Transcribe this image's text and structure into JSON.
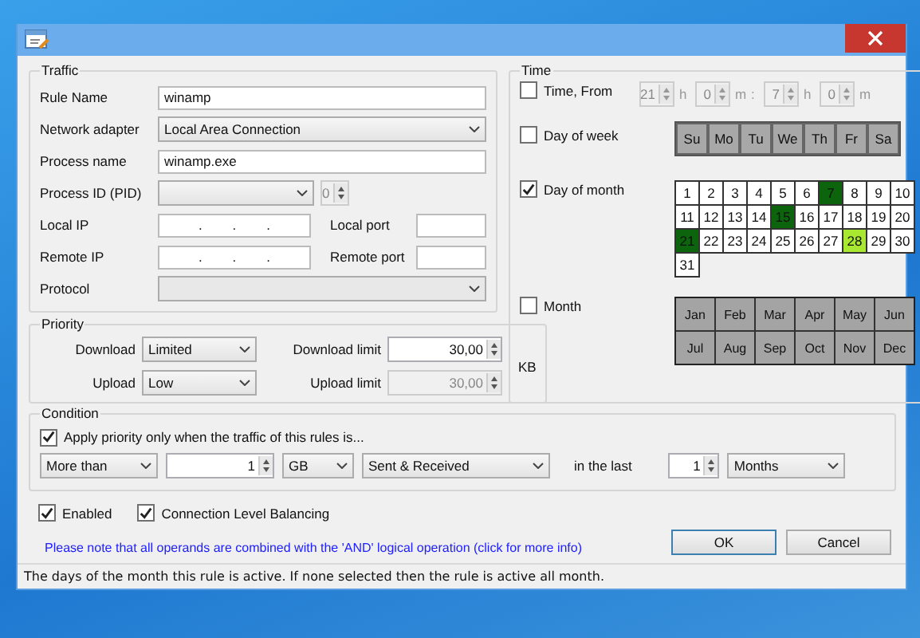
{
  "traffic": {
    "title": "Traffic",
    "rule_name": {
      "label": "Rule Name",
      "value": "winamp"
    },
    "network_adapter": {
      "label": "Network adapter",
      "value": "Local Area Connection"
    },
    "process_name": {
      "label": "Process name",
      "value": "winamp.exe"
    },
    "process_id": {
      "label": "Process ID (PID)",
      "value": "0"
    },
    "local_ip": {
      "label": "Local IP",
      "separators": [
        ".",
        ".",
        "."
      ]
    },
    "local_port": {
      "label": "Local port"
    },
    "remote_ip": {
      "label": "Remote IP",
      "separators": [
        ".",
        ".",
        "."
      ]
    },
    "remote_port": {
      "label": "Remote port"
    },
    "protocol": {
      "label": "Protocol"
    }
  },
  "priority": {
    "title": "Priority",
    "download": {
      "label": "Download",
      "value": "Limited"
    },
    "upload": {
      "label": "Upload",
      "value": "Low"
    },
    "download_limit": {
      "label": "Download limit",
      "value": "30,00",
      "disabled": false
    },
    "upload_limit": {
      "label": "Upload limit",
      "value": "30,00",
      "disabled": true
    },
    "unit": "KB"
  },
  "time": {
    "title": "Time",
    "time_from": {
      "label": "Time, From",
      "checked": false,
      "parts": [
        {
          "kind": "spinner",
          "value": "21",
          "unit": "h"
        },
        {
          "kind": "spinner",
          "value": "0",
          "unit": "m"
        },
        {
          "kind": "separator",
          "value": ":"
        },
        {
          "kind": "spinner",
          "value": "7",
          "unit": "h"
        },
        {
          "kind": "spinner",
          "value": "0",
          "unit": "m"
        }
      ]
    },
    "day_of_week": {
      "label": "Day of week",
      "checked": false,
      "days": [
        {
          "label": "Su",
          "selected": false
        },
        {
          "label": "Mo",
          "selected": false
        },
        {
          "label": "Tu",
          "selected": false
        },
        {
          "label": "We",
          "selected": false
        },
        {
          "label": "Th",
          "selected": false
        },
        {
          "label": "Fr",
          "selected": false
        },
        {
          "label": "Sa",
          "selected": false
        }
      ]
    },
    "day_of_month": {
      "label": "Day of month",
      "checked": true,
      "days": [
        {
          "label": "1",
          "selected": false,
          "today": false
        },
        {
          "label": "2",
          "selected": false,
          "today": false
        },
        {
          "label": "3",
          "selected": false,
          "today": false
        },
        {
          "label": "4",
          "selected": false,
          "today": false
        },
        {
          "label": "5",
          "selected": false,
          "today": false
        },
        {
          "label": "6",
          "selected": false,
          "today": false
        },
        {
          "label": "7",
          "selected": true,
          "today": false
        },
        {
          "label": "8",
          "selected": false,
          "today": false
        },
        {
          "label": "9",
          "selected": false,
          "today": false
        },
        {
          "label": "10",
          "selected": false,
          "today": false
        },
        {
          "label": "11",
          "selected": false,
          "today": false
        },
        {
          "label": "12",
          "selected": false,
          "today": false
        },
        {
          "label": "13",
          "selected": false,
          "today": false
        },
        {
          "label": "14",
          "selected": false,
          "today": false
        },
        {
          "label": "15",
          "selected": true,
          "today": false
        },
        {
          "label": "16",
          "selected": false,
          "today": false
        },
        {
          "label": "17",
          "selected": false,
          "today": false
        },
        {
          "label": "18",
          "selected": false,
          "today": false
        },
        {
          "label": "19",
          "selected": false,
          "today": false
        },
        {
          "label": "20",
          "selected": false,
          "today": false
        },
        {
          "label": "21",
          "selected": true,
          "today": false
        },
        {
          "label": "22",
          "selected": false,
          "today": false
        },
        {
          "label": "23",
          "selected": false,
          "today": false
        },
        {
          "label": "24",
          "selected": false,
          "today": false
        },
        {
          "label": "25",
          "selected": false,
          "today": false
        },
        {
          "label": "26",
          "selected": false,
          "today": false
        },
        {
          "label": "27",
          "selected": false,
          "today": false
        },
        {
          "label": "28",
          "selected": false,
          "today": true
        },
        {
          "label": "29",
          "selected": false,
          "today": false
        },
        {
          "label": "30",
          "selected": false,
          "today": false
        },
        {
          "label": "31",
          "selected": false,
          "today": false
        }
      ]
    },
    "month": {
      "label": "Month",
      "checked": false,
      "months": [
        {
          "label": "Jan",
          "selected": false
        },
        {
          "label": "Feb",
          "selected": false
        },
        {
          "label": "Mar",
          "selected": false
        },
        {
          "label": "Apr",
          "selected": false
        },
        {
          "label": "May",
          "selected": false
        },
        {
          "label": "Jun",
          "selected": false
        },
        {
          "label": "Jul",
          "selected": false
        },
        {
          "label": "Aug",
          "selected": false
        },
        {
          "label": "Sep",
          "selected": false
        },
        {
          "label": "Oct",
          "selected": false
        },
        {
          "label": "Nov",
          "selected": false
        },
        {
          "label": "Dec",
          "selected": false
        }
      ]
    }
  },
  "condition": {
    "title": "Condition",
    "apply": {
      "label": "Apply priority only when the traffic of this rules is...",
      "checked": true
    },
    "comparison": "More than",
    "amount": "1",
    "unit": "GB",
    "direction": "Sent & Received",
    "in_the_last_label": "in the last",
    "period_amount": "1",
    "period_unit": "Months"
  },
  "options": [
    {
      "label": "Enabled",
      "checked": true
    },
    {
      "label": "Connection Level Balancing",
      "checked": true
    }
  ],
  "info_link": "Please note that all operands are combined with the 'AND' logical operation (click for more info)",
  "buttons": [
    {
      "label": "OK",
      "default": true
    },
    {
      "label": "Cancel",
      "default": false
    }
  ],
  "status_bar": "The days of the month this rule is active. If none selected then the rule is active all month."
}
